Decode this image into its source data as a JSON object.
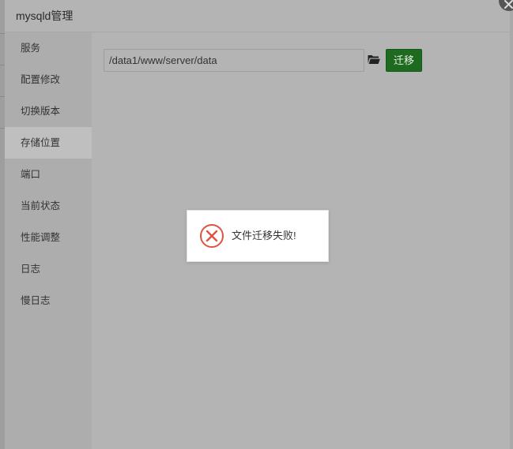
{
  "dialog": {
    "title": "mysqld管理",
    "close_icon": "close-icon"
  },
  "sidebar": {
    "items": [
      {
        "label": "服务"
      },
      {
        "label": "配置修改"
      },
      {
        "label": "切换版本"
      },
      {
        "label": "存储位置",
        "active": true
      },
      {
        "label": "端口"
      },
      {
        "label": "当前状态"
      },
      {
        "label": "性能调整"
      },
      {
        "label": "日志"
      },
      {
        "label": "慢日志"
      }
    ]
  },
  "storage": {
    "path_value": "/data1/www/server/data",
    "folder_icon": "folder-open-icon",
    "migrate_label": "迁移",
    "migrate_color": "#1e6b1f"
  },
  "toast": {
    "icon": "error-icon",
    "message": "文件迁移失败!",
    "icon_color": "#e0533f"
  }
}
